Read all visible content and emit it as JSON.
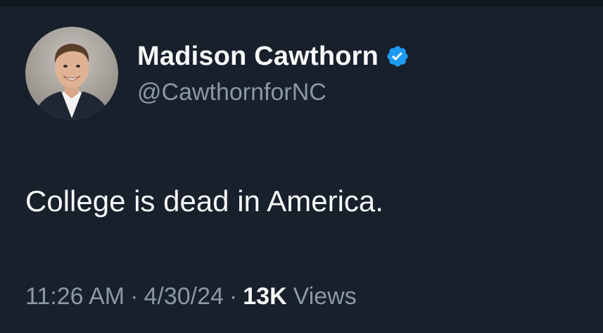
{
  "tweet": {
    "author": {
      "display_name": "Madison Cawthorn",
      "handle": "@CawthornforNC",
      "verified": true,
      "avatar_icon": "profile-photo"
    },
    "text": "College is dead in America.",
    "meta": {
      "time": "11:26 AM",
      "separator": "·",
      "date": "4/30/24",
      "views_count": "13K",
      "views_label": "Views"
    }
  },
  "colors": {
    "background": "#17202b",
    "text_primary": "#f7f9f9",
    "text_secondary": "#8b98a5",
    "verified_badge": "#1d9bf0"
  }
}
